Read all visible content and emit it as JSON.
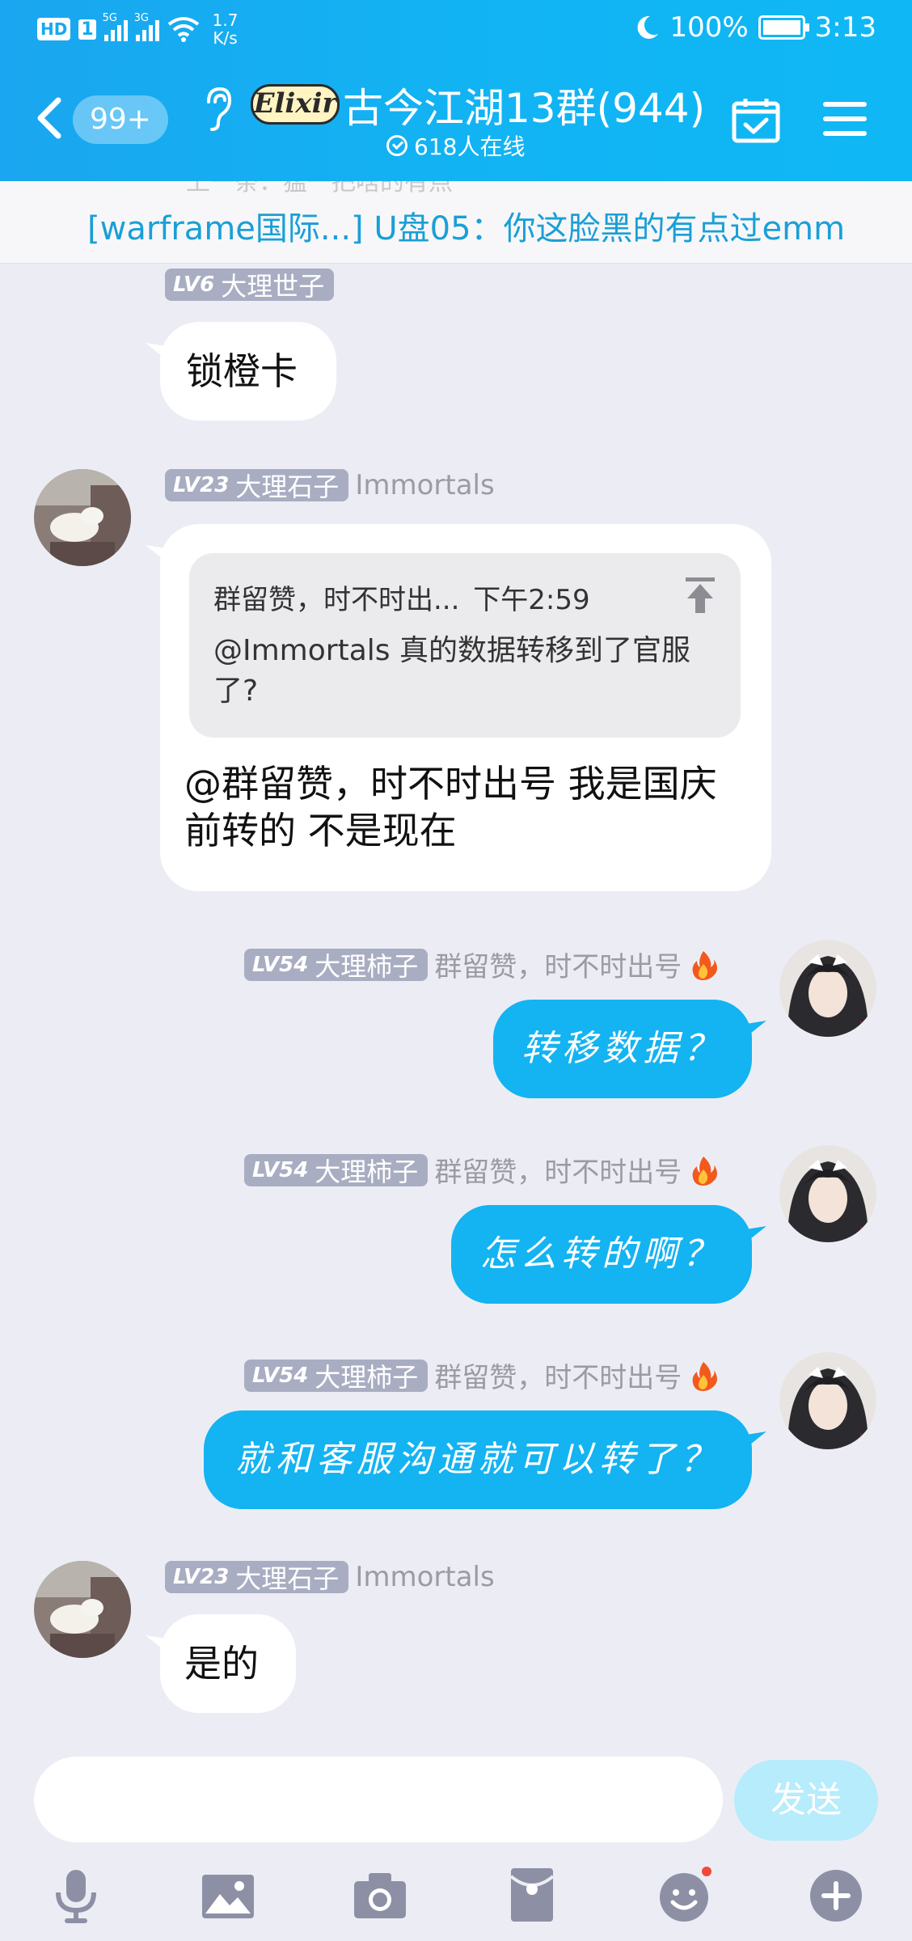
{
  "status_bar": {
    "hd": "HD",
    "sim": "1",
    "net1": "5G",
    "net2": "3G",
    "speed_value": "1.7",
    "speed_unit": "K/s",
    "battery": "100%",
    "time": "3:13"
  },
  "header": {
    "unread_badge": "99+",
    "brand_logo": "Elixir",
    "group_name": "古今江湖13群(944)",
    "online_count": "618人在线"
  },
  "notice": {
    "ghost": "上一条：猛一把啥的有点",
    "text": "[warframe国际...] U盘05：你这脸黑的有点过emm"
  },
  "messages": [
    {
      "side": "left",
      "level": "LV6",
      "title": "大理世子",
      "nickname": "",
      "text": "锁橙卡"
    },
    {
      "side": "left",
      "level": "LV23",
      "title": "大理石子",
      "nickname": "Immortals",
      "quote": {
        "author": "群留赞，时不时出...",
        "time": "下午2:59",
        "text": "@Immortals 真的数据转移到了官服了?"
      },
      "text": "@群留赞，时不时出号 我是国庆前转的  不是现在"
    },
    {
      "side": "right",
      "level": "LV54",
      "title": "大理柿子",
      "nickname": "群留赞，时不时出号",
      "text": "转移数据？"
    },
    {
      "side": "right",
      "level": "LV54",
      "title": "大理柿子",
      "nickname": "群留赞，时不时出号",
      "text": "怎么转的啊？"
    },
    {
      "side": "right",
      "level": "LV54",
      "title": "大理柿子",
      "nickname": "群留赞，时不时出号",
      "text": "就和客服沟通就可以转了？"
    },
    {
      "side": "left",
      "level": "LV23",
      "title": "大理石子",
      "nickname": "Immortals",
      "text": "是的"
    }
  ],
  "input": {
    "placeholder": "",
    "send_label": "发送"
  },
  "toolbar": [
    "microphone-icon",
    "image-icon",
    "camera-icon",
    "red-packet-icon",
    "emoji-icon",
    "plus-icon"
  ],
  "colors": {
    "header": "#12b3f3",
    "bubble_self": "#14b3f2",
    "notice_text": "#1a9fd6",
    "background": "#ecedf4"
  }
}
